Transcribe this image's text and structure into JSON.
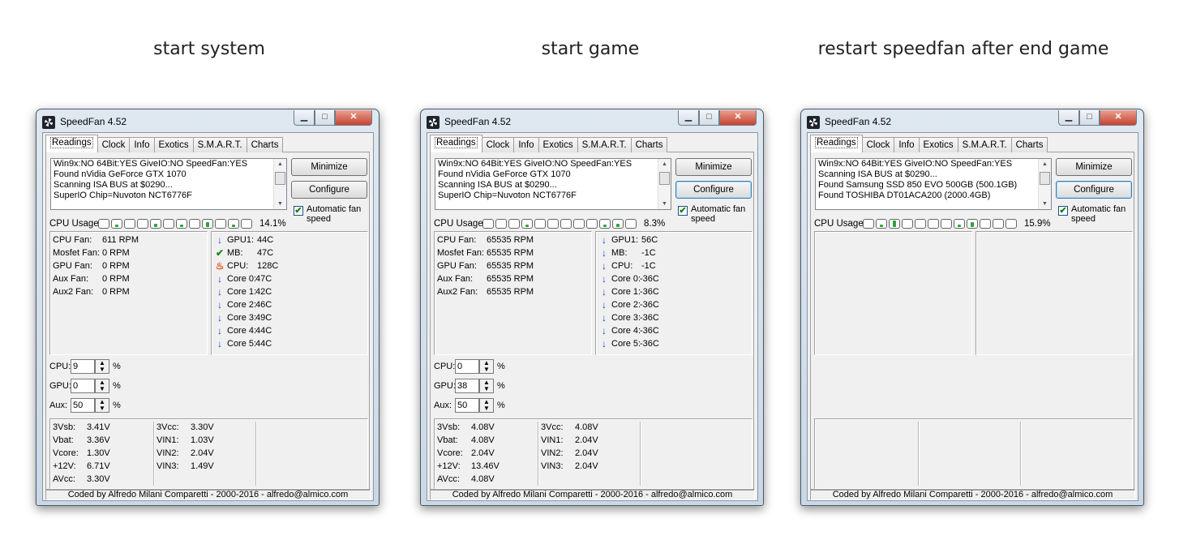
{
  "captions": [
    "start system",
    "start game",
    "restart speedfan after end game"
  ],
  "windows": [
    {
      "title": "SpeedFan 4.52",
      "tabs": [
        "Readings",
        "Clock",
        "Info",
        "Exotics",
        "S.M.A.R.T.",
        "Charts"
      ],
      "log_lines": [
        "Win9x:NO  64Bit:YES  GiveIO:NO  SpeedFan:YES",
        "Found nVidia GeForce GTX 1070",
        "Scanning ISA BUS at $0290...",
        "SuperIO Chip=Nuvoton NCT6776F"
      ],
      "minimize_label": "Minimize",
      "configure_label": "Configure",
      "auto_fan_label": "Automatic fan speed",
      "auto_fan_checked": "✔",
      "cpu_usage_label": "CPU Usage",
      "cpu_bar_fills": [
        0,
        0.05,
        0,
        0,
        0.1,
        0,
        0.05,
        0,
        0.15,
        0,
        0.05,
        0
      ],
      "cpu_pct": "14.1%",
      "fans": [
        {
          "label": "CPU Fan:",
          "value": "611 RPM"
        },
        {
          "label": "Mosfet Fan:",
          "value": "0 RPM"
        },
        {
          "label": "GPU Fan:",
          "value": "0 RPM"
        },
        {
          "label": "Aux Fan:",
          "value": "0 RPM"
        },
        {
          "label": "Aux2 Fan:",
          "value": "0 RPM"
        }
      ],
      "temps": [
        {
          "icon": "down-arrow-icon",
          "label": "GPU1:",
          "value": "44C"
        },
        {
          "icon": "checkmark-icon",
          "label": "MB:",
          "value": "47C"
        },
        {
          "icon": "flame-icon",
          "label": "CPU:",
          "value": "128C"
        },
        {
          "icon": "down-arrow-icon",
          "label": "Core 0:",
          "value": "47C"
        },
        {
          "icon": "down-arrow-icon",
          "label": "Core 1:",
          "value": "42C"
        },
        {
          "icon": "down-arrow-icon",
          "label": "Core 2:",
          "value": "46C"
        },
        {
          "icon": "down-arrow-icon",
          "label": "Core 3:",
          "value": "49C"
        },
        {
          "icon": "down-arrow-icon",
          "label": "Core 4:",
          "value": "44C"
        },
        {
          "icon": "down-arrow-icon",
          "label": "Core 5:",
          "value": "44C"
        }
      ],
      "speeds": [
        {
          "label": "CPU:",
          "value": "9",
          "pct": "%"
        },
        {
          "label": "GPU:",
          "value": "0",
          "pct": "%"
        },
        {
          "label": "Aux:",
          "value": "50",
          "pct": "%"
        }
      ],
      "volts_col1": [
        {
          "label": "3Vsb:",
          "value": "3.41V"
        },
        {
          "label": "Vbat:",
          "value": "3.36V"
        },
        {
          "label": "Vcore:",
          "value": "1.30V"
        },
        {
          "label": "+12V:",
          "value": "6.71V"
        },
        {
          "label": "AVcc:",
          "value": "3.30V"
        }
      ],
      "volts_col2": [
        {
          "label": "3Vcc:",
          "value": "3.30V"
        },
        {
          "label": "VIN1:",
          "value": "1.03V"
        },
        {
          "label": "VIN2:",
          "value": "2.04V"
        },
        {
          "label": "VIN3:",
          "value": "1.49V"
        }
      ],
      "status": "Coded by Alfredo Milani Comparetti - 2000-2016 - alfredo@almico.com"
    },
    {
      "title": "SpeedFan 4.52",
      "tabs": [
        "Readings",
        "Clock",
        "Info",
        "Exotics",
        "S.M.A.R.T.",
        "Charts"
      ],
      "log_lines": [
        "Win9x:NO  64Bit:YES  GiveIO:NO  SpeedFan:YES",
        "Found nVidia GeForce GTX 1070",
        "Scanning ISA BUS at $0290...",
        "SuperIO Chip=Nuvoton NCT6776F"
      ],
      "minimize_label": "Minimize",
      "configure_label": "Configure",
      "auto_fan_label": "Automatic fan speed",
      "auto_fan_checked": "✔",
      "cpu_usage_label": "CPU Usage",
      "cpu_bar_fills": [
        0,
        0,
        0,
        0.05,
        0,
        0,
        0,
        0,
        0,
        0.05,
        0.1,
        0
      ],
      "cpu_pct": "8.3%",
      "fans": [
        {
          "label": "CPU Fan:",
          "value": "65535 RPM"
        },
        {
          "label": "Mosfet Fan:",
          "value": "65535 RPM"
        },
        {
          "label": "GPU Fan:",
          "value": "65535 RPM"
        },
        {
          "label": "Aux Fan:",
          "value": "65535 RPM"
        },
        {
          "label": "Aux2 Fan:",
          "value": "65535 RPM"
        }
      ],
      "temps": [
        {
          "icon": "down-arrow-icon",
          "label": "GPU1:",
          "value": "56C"
        },
        {
          "icon": "down-arrow-icon",
          "label": "MB:",
          "value": "-1C"
        },
        {
          "icon": "down-arrow-icon",
          "label": "CPU:",
          "value": "-1C"
        },
        {
          "icon": "down-arrow-icon",
          "label": "Core 0:",
          "value": "-36C"
        },
        {
          "icon": "down-arrow-icon",
          "label": "Core 1:",
          "value": "-36C"
        },
        {
          "icon": "down-arrow-icon",
          "label": "Core 2:",
          "value": "-36C"
        },
        {
          "icon": "down-arrow-icon",
          "label": "Core 3:",
          "value": "-36C"
        },
        {
          "icon": "down-arrow-icon",
          "label": "Core 4:",
          "value": "-36C"
        },
        {
          "icon": "down-arrow-icon",
          "label": "Core 5:",
          "value": "-36C"
        }
      ],
      "speeds": [
        {
          "label": "CPU:",
          "value": "0",
          "pct": "%"
        },
        {
          "label": "GPU:",
          "value": "38",
          "pct": "%"
        },
        {
          "label": "Aux:",
          "value": "50",
          "pct": "%"
        }
      ],
      "volts_col1": [
        {
          "label": "3Vsb:",
          "value": "4.08V"
        },
        {
          "label": "Vbat:",
          "value": "4.08V"
        },
        {
          "label": "Vcore:",
          "value": "2.04V"
        },
        {
          "label": "+12V:",
          "value": "13.46V"
        },
        {
          "label": "AVcc:",
          "value": "4.08V"
        }
      ],
      "volts_col2": [
        {
          "label": "3Vcc:",
          "value": "4.08V"
        },
        {
          "label": "VIN1:",
          "value": "2.04V"
        },
        {
          "label": "VIN2:",
          "value": "2.04V"
        },
        {
          "label": "VIN3:",
          "value": "2.04V"
        }
      ],
      "status": "Coded by Alfredo Milani Comparetti - 2000-2016 - alfredo@almico.com"
    },
    {
      "title": "SpeedFan 4.52",
      "tabs": [
        "Readings",
        "Clock",
        "Info",
        "Exotics",
        "S.M.A.R.T.",
        "Charts"
      ],
      "log_lines": [
        "Win9x:NO  64Bit:YES  GiveIO:NO  SpeedFan:YES",
        "Scanning ISA BUS at $0290...",
        "Found Samsung SSD 850 EVO 500GB (500.1GB)",
        "Found TOSHIBA DT01ACA200 (2000.4GB)"
      ],
      "minimize_label": "Minimize",
      "configure_label": "Configure",
      "auto_fan_label": "Automatic fan speed",
      "auto_fan_checked": "✔",
      "cpu_usage_label": "CPU Usage",
      "cpu_bar_fills": [
        0,
        0.05,
        0.2,
        0,
        0,
        0,
        0,
        0.05,
        0.15,
        0,
        0,
        0
      ],
      "cpu_pct": "15.9%",
      "fans": [],
      "temps": [],
      "speeds": [],
      "volts_col1": [],
      "volts_col2": [],
      "status": "Coded by Alfredo Milani Comparetti - 2000-2016 - alfredo@almico.com"
    }
  ]
}
